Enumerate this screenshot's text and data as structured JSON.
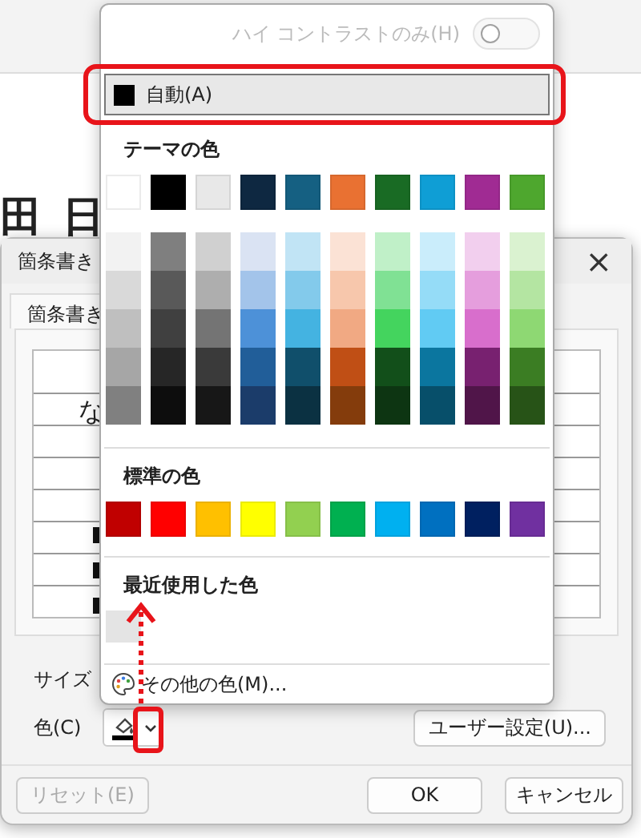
{
  "document": {
    "glyphs": "田 日"
  },
  "dialog": {
    "title": "箇条書き",
    "close": "×",
    "tab": {
      "label": "箇条書き",
      "selected": true
    },
    "preview_char": "な",
    "size_label": "サイズ",
    "color_label": "色(C)",
    "custom_button": "ユーザー設定(U)...",
    "reset_button": {
      "label": "リセット(E)",
      "disabled": true
    },
    "ok_button": "OK",
    "cancel_button": "キャンセル"
  },
  "color_menu": {
    "high_contrast": {
      "label": "ハイ コントラストのみ(H)",
      "on": false,
      "disabled": true
    },
    "automatic": {
      "label": "自動(A)",
      "color": "#000000",
      "selected": true
    },
    "theme_heading": "テーマの色",
    "theme_colors": [
      {
        "color": "#ffffff",
        "shades": [
          {
            "color": "#f2f2f2"
          },
          {
            "color": "#d9d9d9"
          },
          {
            "color": "#bfbfbf"
          },
          {
            "color": "#a6a6a6"
          },
          {
            "color": "#808080"
          }
        ]
      },
      {
        "color": "#000000",
        "shades": [
          {
            "color": "#7f7f7f"
          },
          {
            "color": "#595959"
          },
          {
            "color": "#404040"
          },
          {
            "color": "#262626"
          },
          {
            "color": "#0d0d0d"
          }
        ]
      },
      {
        "color": "#e8e8e8",
        "shades": [
          {
            "color": "#d0d0d0"
          },
          {
            "color": "#aeaeae"
          },
          {
            "color": "#747474"
          },
          {
            "color": "#3a3a3a"
          },
          {
            "color": "#171717"
          }
        ]
      },
      {
        "color": "#0e2841",
        "shades": [
          {
            "color": "#dae3f3"
          },
          {
            "color": "#a3c4ea"
          },
          {
            "color": "#4d91d8"
          },
          {
            "color": "#215e99"
          },
          {
            "color": "#1b3c6a"
          }
        ]
      },
      {
        "color": "#156082",
        "shades": [
          {
            "color": "#c1e4f5"
          },
          {
            "color": "#83caeb"
          },
          {
            "color": "#44b3e1"
          },
          {
            "color": "#104f6b"
          },
          {
            "color": "#0b3142"
          }
        ]
      },
      {
        "color": "#e97132",
        "shades": [
          {
            "color": "#fbe2d5"
          },
          {
            "color": "#f7c7ac"
          },
          {
            "color": "#f1a983"
          },
          {
            "color": "#c04f15"
          },
          {
            "color": "#843c0c"
          }
        ]
      },
      {
        "color": "#196b24",
        "shades": [
          {
            "color": "#c0f0c8"
          },
          {
            "color": "#80e194"
          },
          {
            "color": "#44d45e"
          },
          {
            "color": "#124f1a"
          },
          {
            "color": "#0d3512"
          }
        ]
      },
      {
        "color": "#0f9ed5",
        "shades": [
          {
            "color": "#caedfb"
          },
          {
            "color": "#95dcf7"
          },
          {
            "color": "#61cbf3"
          },
          {
            "color": "#0b769f"
          },
          {
            "color": "#074f6a"
          }
        ]
      },
      {
        "color": "#a02b93",
        "shades": [
          {
            "color": "#f2cfee"
          },
          {
            "color": "#e59edd"
          },
          {
            "color": "#d86ecc"
          },
          {
            "color": "#782170"
          },
          {
            "color": "#501549"
          }
        ]
      },
      {
        "color": "#4ea72e",
        "shades": [
          {
            "color": "#daf2d0"
          },
          {
            "color": "#b4e5a2"
          },
          {
            "color": "#8ed873"
          },
          {
            "color": "#3b7d23"
          },
          {
            "color": "#275317"
          }
        ]
      }
    ],
    "standard_heading": "標準の色",
    "standard_colors": [
      {
        "color": "#c00000"
      },
      {
        "color": "#ff0000"
      },
      {
        "color": "#ffc000"
      },
      {
        "color": "#ffff00"
      },
      {
        "color": "#92d050"
      },
      {
        "color": "#00b050"
      },
      {
        "color": "#00b0f0"
      },
      {
        "color": "#0070c0"
      },
      {
        "color": "#002060"
      },
      {
        "color": "#7030a0"
      }
    ],
    "recent_heading": "最近使用した色",
    "recent_colors": [
      {
        "color": "#e4e4e4"
      }
    ],
    "more_colors": "その他の色(M)..."
  }
}
